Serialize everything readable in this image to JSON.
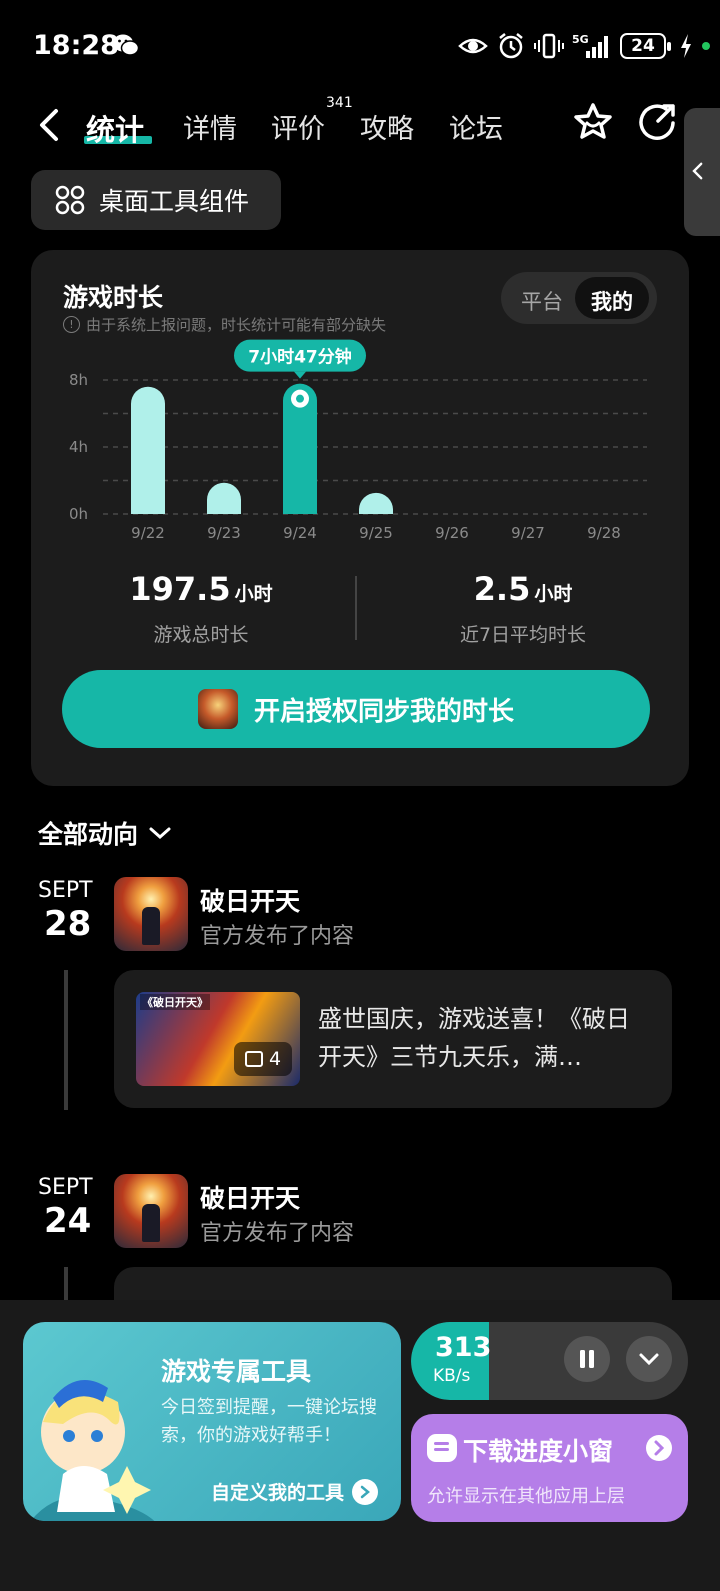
{
  "status_bar": {
    "time": "18:28",
    "network": "5G",
    "battery": "24"
  },
  "nav": {
    "tabs": [
      {
        "label": "统计",
        "active": true
      },
      {
        "label": "详情"
      },
      {
        "label": "评价",
        "badge": "341"
      },
      {
        "label": "攻略"
      },
      {
        "label": "论坛"
      }
    ]
  },
  "widget_button": "桌面工具组件",
  "stats": {
    "title": "游戏时长",
    "note": "由于系统上报问题，时长统计可能有部分缺失",
    "toggle": {
      "options": [
        "平台",
        "我的"
      ],
      "active": "我的"
    },
    "tooltip": "7小时47分钟",
    "total": {
      "value": "197.5",
      "unit": "小时",
      "caption": "游戏总时长"
    },
    "average": {
      "value": "2.5",
      "unit": "小时",
      "caption": "近7日平均时长"
    },
    "sync_button": "开启授权同步我的时长"
  },
  "chart_data": {
    "type": "bar",
    "categories": [
      "9/22",
      "9/23",
      "9/24",
      "9/25",
      "9/26",
      "9/27",
      "9/28"
    ],
    "values": [
      7.6,
      1.7,
      7.78,
      0.5,
      0,
      0,
      0
    ],
    "highlight_index": 2,
    "y_ticks": [
      "0h",
      "4h",
      "8h"
    ],
    "ylim": [
      0,
      8
    ],
    "grid": true,
    "colors": {
      "bar": "#b0f0ea",
      "highlight": "#16b7a7"
    }
  },
  "feed": {
    "header": "全部动向",
    "posts": [
      {
        "month": "SEPT",
        "day": "28",
        "name": "破日开天",
        "subtitle": "官方发布了内容",
        "image_caption": "《破日开天》",
        "image_count": "4",
        "text": "盛世国庆，游戏送喜！《破日开天》三节九天乐，满…"
      },
      {
        "month": "SEPT",
        "day": "24",
        "name": "破日开天",
        "subtitle": "官方发布了内容"
      }
    ]
  },
  "bottom": {
    "tool_card": {
      "title": "游戏专属工具",
      "desc": "今日签到提醒，一键论坛搜索，你的游戏好帮手！",
      "link": "自定义我的工具"
    },
    "download": {
      "speed": "313",
      "unit": "KB/s",
      "progress": 0.28
    },
    "float_window": {
      "title": "下载进度小窗",
      "desc": "允许显示在其他应用上层"
    }
  },
  "colors": {
    "accent": "#16b7a7",
    "purple": "#b57ee8",
    "card": "#1c1c1c"
  }
}
